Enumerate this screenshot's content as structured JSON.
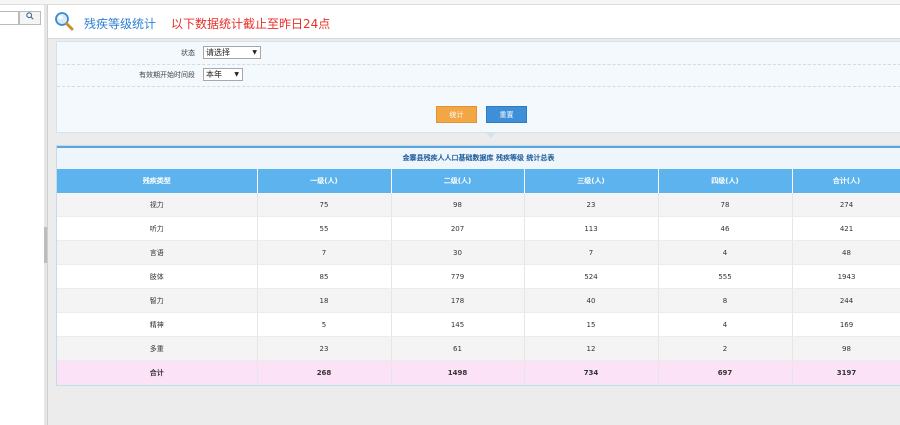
{
  "window": {
    "top_text": "...... ...... ......"
  },
  "sidebar": {
    "search_icon": "search-icon"
  },
  "header": {
    "title": "残疾等级统计",
    "note": "以下数据统计截止至昨日24点",
    "icon": "magnifier-icon"
  },
  "filters": {
    "status_label": "状态",
    "status_value": "请选择",
    "period_label": "有效期开始时间段",
    "period_value": "本年",
    "stat_button": "统计",
    "reset_button": "重置"
  },
  "report": {
    "title": "金寨县残疾人人口基础数据库 残疾等级 统计总表",
    "columns": [
      "残疾类型",
      "一级(人)",
      "二级(人)",
      "三级(人)",
      "四级(人)",
      "合计(人)"
    ],
    "rows": [
      [
        "视力",
        "75",
        "98",
        "23",
        "78",
        "274"
      ],
      [
        "听力",
        "55",
        "207",
        "113",
        "46",
        "421"
      ],
      [
        "言语",
        "7",
        "30",
        "7",
        "4",
        "48"
      ],
      [
        "肢体",
        "85",
        "779",
        "524",
        "555",
        "1943"
      ],
      [
        "智力",
        "18",
        "178",
        "40",
        "8",
        "244"
      ],
      [
        "精神",
        "5",
        "145",
        "15",
        "4",
        "169"
      ],
      [
        "多重",
        "23",
        "61",
        "12",
        "2",
        "98"
      ]
    ],
    "total": [
      "合计",
      "268",
      "1498",
      "734",
      "697",
      "3197"
    ]
  },
  "colors": {
    "title_blue": "#2b7fd6",
    "note_red": "#e8302a",
    "header_blue": "#5cb3ee",
    "stat_orange": "#f2a744",
    "reset_blue": "#3d8fd8",
    "total_pink": "#fbe2f7"
  }
}
